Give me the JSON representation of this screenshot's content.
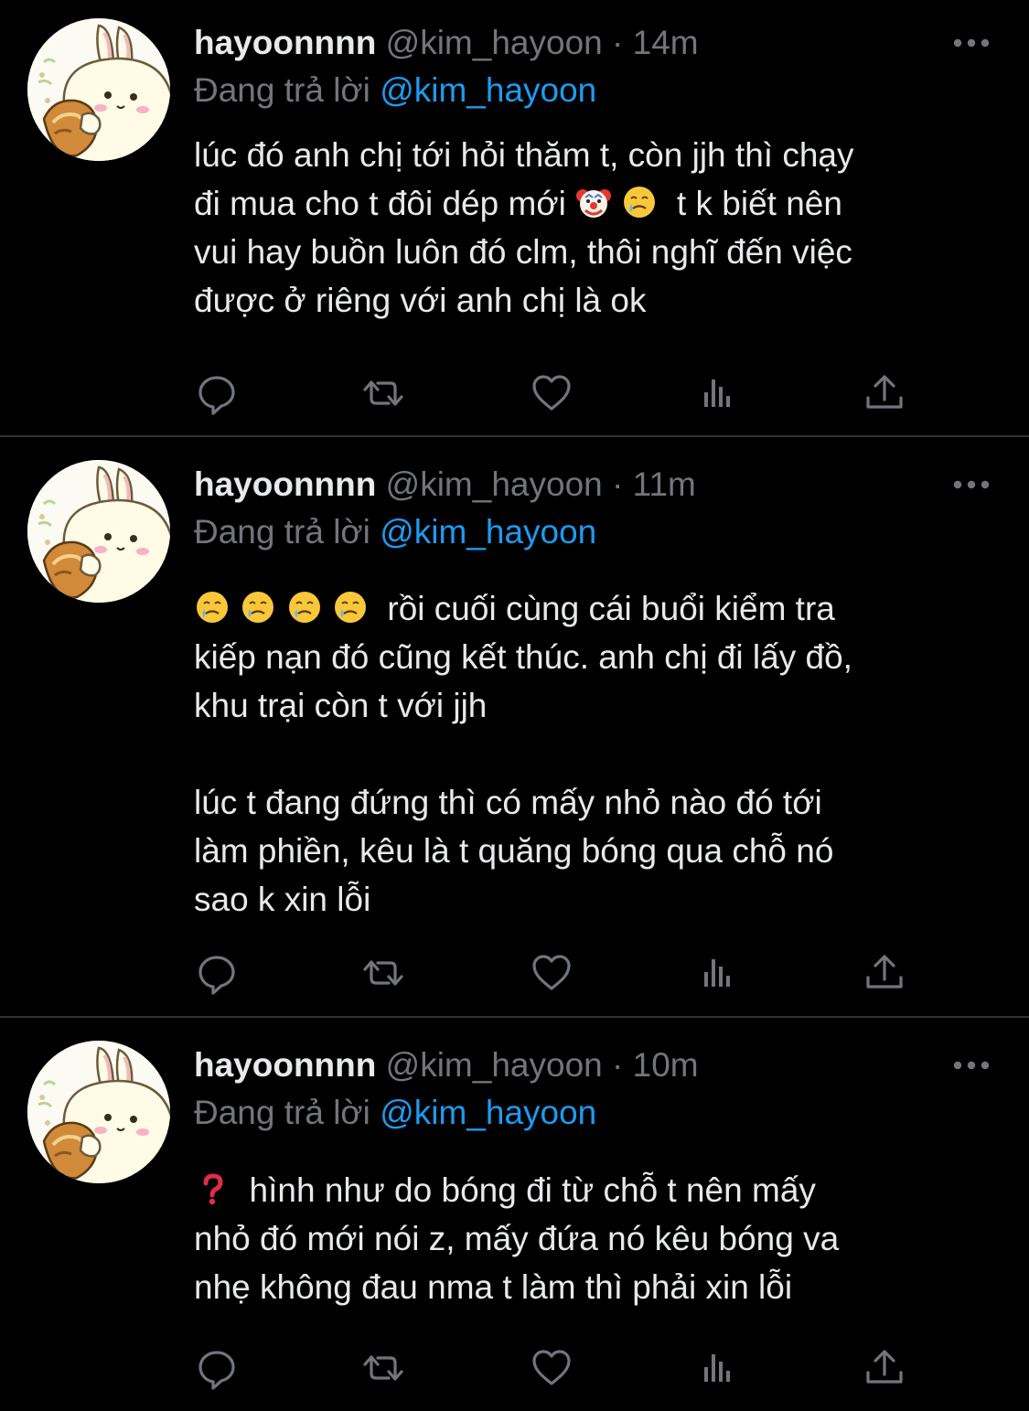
{
  "colors": {
    "background": "#000000",
    "text": "#e7e9ea",
    "secondary": "#71767b",
    "accent": "#1d9bf0",
    "divider": "#2f3336"
  },
  "tweets": [
    {
      "display_name": "hayoonnnn",
      "handle": "@kim_hayoon",
      "separator": "·",
      "time": "14m",
      "replying_prefix": "Đang trả lời",
      "replying_to": "@kim_hayoon",
      "lines": [
        {
          "text": "lúc đó anh chị tới hỏi thăm t, còn jjh thì chạy"
        },
        {
          "before": "đi mua cho t đôi dép mới",
          "emojis": [
            "clown-face-emoji",
            "crying-smile-emoji"
          ],
          "after": "t k biết nên"
        },
        {
          "text": "vui hay buồn luôn đó clm, thôi nghĩ đến việc"
        },
        {
          "text": "được ở riêng với anh chị là ok"
        }
      ]
    },
    {
      "display_name": "hayoonnnn",
      "handle": "@kim_hayoon",
      "separator": "·",
      "time": "11m",
      "replying_prefix": "Đang trả lời",
      "replying_to": "@kim_hayoon",
      "lines": [
        {
          "before": "",
          "emojis": [
            "crying-smile-emoji",
            "crying-smile-emoji",
            "crying-smile-emoji",
            "crying-smile-emoji"
          ],
          "after": "rồi cuối cùng cái buổi kiểm tra"
        },
        {
          "text": "kiếp nạn đó cũng kết thúc. anh chị đi lấy đồ,"
        },
        {
          "text": "khu trại còn t với jjh"
        },
        {
          "text": ""
        },
        {
          "text": "lúc t đang đứng thì có mấy nhỏ nào đó tới"
        },
        {
          "text": "làm phiền, kêu là t quăng bóng qua chỗ nó"
        },
        {
          "text": "sao k xin lỗi"
        }
      ]
    },
    {
      "display_name": "hayoonnnn",
      "handle": "@kim_hayoon",
      "separator": "·",
      "time": "10m",
      "replying_prefix": "Đang trả lời",
      "replying_to": "@kim_hayoon",
      "lines": [
        {
          "before": "",
          "emojis": [
            "red-question-mark-emoji"
          ],
          "after": "hình như do bóng đi từ chỗ t nên mấy"
        },
        {
          "text": "nhỏ đó mới nói z, mấy đứa nó kêu bóng va"
        },
        {
          "text": "nhẹ không đau nma t làm thì phải xin lỗi"
        }
      ]
    }
  ],
  "action_icons": [
    "reply-icon",
    "retweet-icon",
    "like-icon",
    "views-icon",
    "share-icon"
  ]
}
